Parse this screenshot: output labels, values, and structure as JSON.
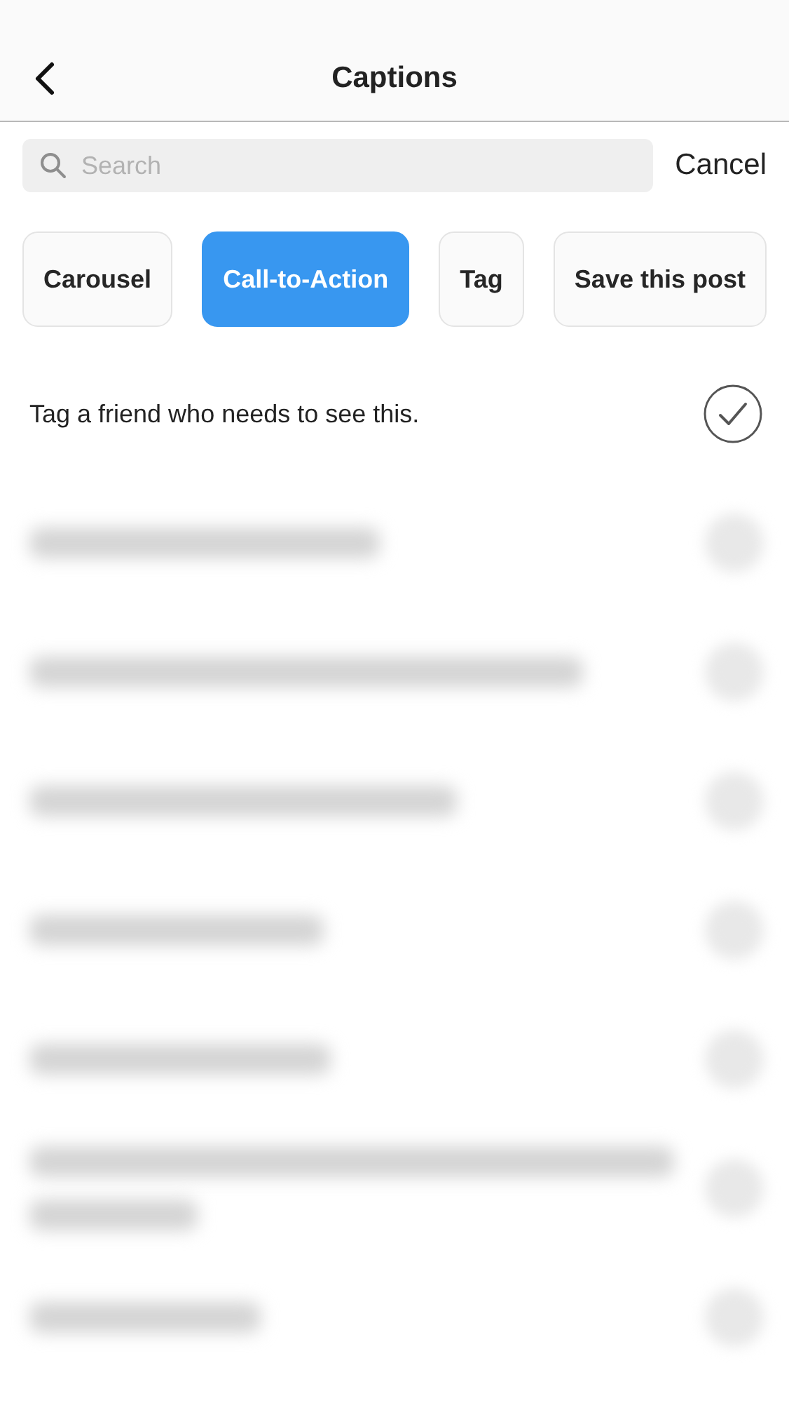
{
  "header": {
    "title": "Captions"
  },
  "search": {
    "placeholder": "Search",
    "cancel": "Cancel"
  },
  "categories": [
    {
      "label": "Carousel",
      "selected": false
    },
    {
      "label": "Call-to-Action",
      "selected": true
    },
    {
      "label": "Tag",
      "selected": false
    },
    {
      "label": "Save this post",
      "selected": false
    }
  ],
  "captions": [
    {
      "kind": "caption",
      "text": "Tag a friend who needs to see this.",
      "checked": true
    },
    {
      "kind": "blurred"
    },
    {
      "kind": "blurred"
    },
    {
      "kind": "blurred"
    },
    {
      "kind": "blurred"
    },
    {
      "kind": "blurred"
    },
    {
      "kind": "blurred_two_line"
    },
    {
      "kind": "blurred"
    }
  ]
}
